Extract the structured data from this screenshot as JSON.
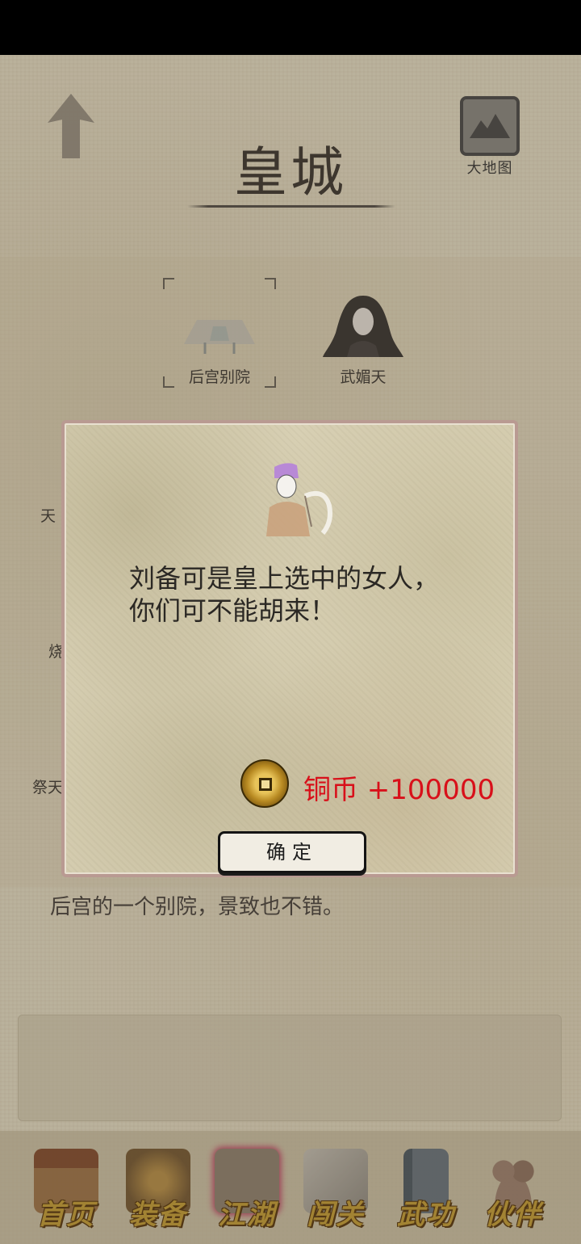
{
  "header": {
    "title": "皇城",
    "map_label": "大地图"
  },
  "locations": [
    {
      "label": "后宫别院",
      "icon": "pavilion-icon"
    },
    {
      "label": "武媚天",
      "icon": "woman-portrait-icon"
    }
  ],
  "partial_labels": [
    "天",
    "烧",
    "祭天"
  ],
  "description": "后宫的一个别院，景致也不错。",
  "dialog": {
    "message": "刘备可是皇上选中的女人，你们可不能胡来！",
    "reward_label": "铜币 +100000",
    "confirm_label": "确定"
  },
  "nav": [
    {
      "label": "首页",
      "icon": "home-icon"
    },
    {
      "label": "装备",
      "icon": "armor-icon"
    },
    {
      "label": "江湖",
      "icon": "scroll-map-icon"
    },
    {
      "label": "闯关",
      "icon": "swords-icon"
    },
    {
      "label": "武功",
      "icon": "book-icon"
    },
    {
      "label": "伙伴",
      "icon": "partners-icon"
    }
  ],
  "colors": {
    "paper": "#ebe3cb",
    "reward_red": "#d8101a",
    "nav_gold": "#c9a23a"
  }
}
